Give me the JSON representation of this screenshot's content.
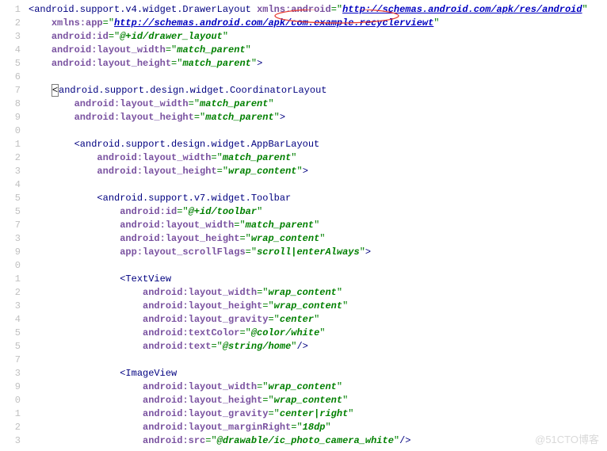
{
  "watermark": "@51CTO博客",
  "lines": {
    "l1": {
      "n": "1",
      "indent": 0,
      "open_br": true,
      "tag": "android.support.v4.widget.DrawerLayout",
      "sp": true,
      "attr": "xmlns:android",
      "valtype": "link",
      "val": "http://schemas.android.com/apk/res/android",
      "close_q": true
    },
    "l2": {
      "n": "2",
      "indent": 4,
      "attr": "xmlns:app",
      "valtype": "link",
      "val": "http://schemas.android.com/apk/com.example.recyclerviewt",
      "close_q": true
    },
    "l3": {
      "n": "3",
      "indent": 4,
      "attr": "android:id",
      "val": "@+id/drawer_layout",
      "close_q": true
    },
    "l4": {
      "n": "4",
      "indent": 4,
      "attr": "android:layout_width",
      "val": "match_parent",
      "close_q": true
    },
    "l5": {
      "n": "5",
      "indent": 4,
      "attr": "android:layout_height",
      "val": "match_parent",
      "close_gt": true
    },
    "l6": {
      "n": "6",
      "blank": true
    },
    "l7": {
      "n": "7",
      "indent": 4,
      "box_open": true,
      "tag": "android.support.design.widget.CoordinatorLayout"
    },
    "l8": {
      "n": "8",
      "indent": 8,
      "attr": "android:layout_width",
      "val": "match_parent",
      "close_q": true
    },
    "l9": {
      "n": "9",
      "indent": 8,
      "attr": "android:layout_height",
      "val": "match_parent",
      "close_gt": true
    },
    "l10": {
      "n": "0",
      "blank": true
    },
    "l11": {
      "n": "1",
      "indent": 8,
      "open_br": true,
      "tag": "android.support.design.widget.AppBarLayout"
    },
    "l12": {
      "n": "2",
      "indent": 12,
      "attr": "android:layout_width",
      "val": "match_parent",
      "close_q": true
    },
    "l13": {
      "n": "3",
      "indent": 12,
      "attr": "android:layout_height",
      "val": "wrap_content",
      "close_gt": true
    },
    "l14": {
      "n": "4",
      "blank": true
    },
    "l15": {
      "n": "5",
      "indent": 12,
      "open_br": true,
      "tag": "android.support.v7.widget.Toolbar"
    },
    "l16": {
      "n": "5",
      "indent": 16,
      "attr": "android:id",
      "val": "@+id/toolbar",
      "close_q": true
    },
    "l17": {
      "n": "7",
      "indent": 16,
      "attr": "android:layout_width",
      "val": "match_parent",
      "close_q": true
    },
    "l18": {
      "n": "3",
      "indent": 16,
      "attr": "android:layout_height",
      "val": "wrap_content",
      "close_q": true
    },
    "l19": {
      "n": "9",
      "indent": 16,
      "attr": "app:layout_scrollFlags",
      "val": "scroll|enterAlways",
      "close_gt": true
    },
    "l20": {
      "n": "0",
      "blank": true
    },
    "l21": {
      "n": "1",
      "indent": 16,
      "open_br": true,
      "tag": "TextView"
    },
    "l22": {
      "n": "2",
      "indent": 20,
      "attr": "android:layout_width",
      "val": "wrap_content",
      "close_q": true
    },
    "l23": {
      "n": "3",
      "indent": 20,
      "attr": "android:layout_height",
      "val": "wrap_content",
      "close_q": true
    },
    "l24": {
      "n": "4",
      "indent": 20,
      "attr": "android:layout_gravity",
      "val": "center",
      "close_q": true
    },
    "l25": {
      "n": "5",
      "indent": 20,
      "attr": "android:textColor",
      "val": "@color/white",
      "close_q": true
    },
    "l26": {
      "n": "5",
      "indent": 20,
      "attr": "android:text",
      "val": "@string/home",
      "close_self": true
    },
    "l27": {
      "n": "7",
      "blank": true
    },
    "l28": {
      "n": "3",
      "indent": 16,
      "open_br": true,
      "tag": "ImageView"
    },
    "l29": {
      "n": "9",
      "indent": 20,
      "attr": "android:layout_width",
      "val": "wrap_content",
      "close_q": true
    },
    "l30": {
      "n": "0",
      "indent": 20,
      "attr": "android:layout_height",
      "val": "wrap_content",
      "close_q": true
    },
    "l31": {
      "n": "1",
      "indent": 20,
      "attr": "android:layout_gravity",
      "val": "center|right",
      "close_q": true
    },
    "l32": {
      "n": "2",
      "indent": 20,
      "attr": "android:layout_marginRight",
      "val": "18dp",
      "close_q": true
    },
    "l33": {
      "n": "3",
      "indent": 20,
      "attr": "android:src",
      "val": "@drawable/ic_photo_camera_white",
      "close_self": true
    }
  },
  "order": [
    "l1",
    "l2",
    "l3",
    "l4",
    "l5",
    "l6",
    "l7",
    "l8",
    "l9",
    "l10",
    "l11",
    "l12",
    "l13",
    "l14",
    "l15",
    "l16",
    "l17",
    "l18",
    "l19",
    "l20",
    "l21",
    "l22",
    "l23",
    "l24",
    "l25",
    "l26",
    "l27",
    "l28",
    "l29",
    "l30",
    "l31",
    "l32",
    "l33"
  ]
}
